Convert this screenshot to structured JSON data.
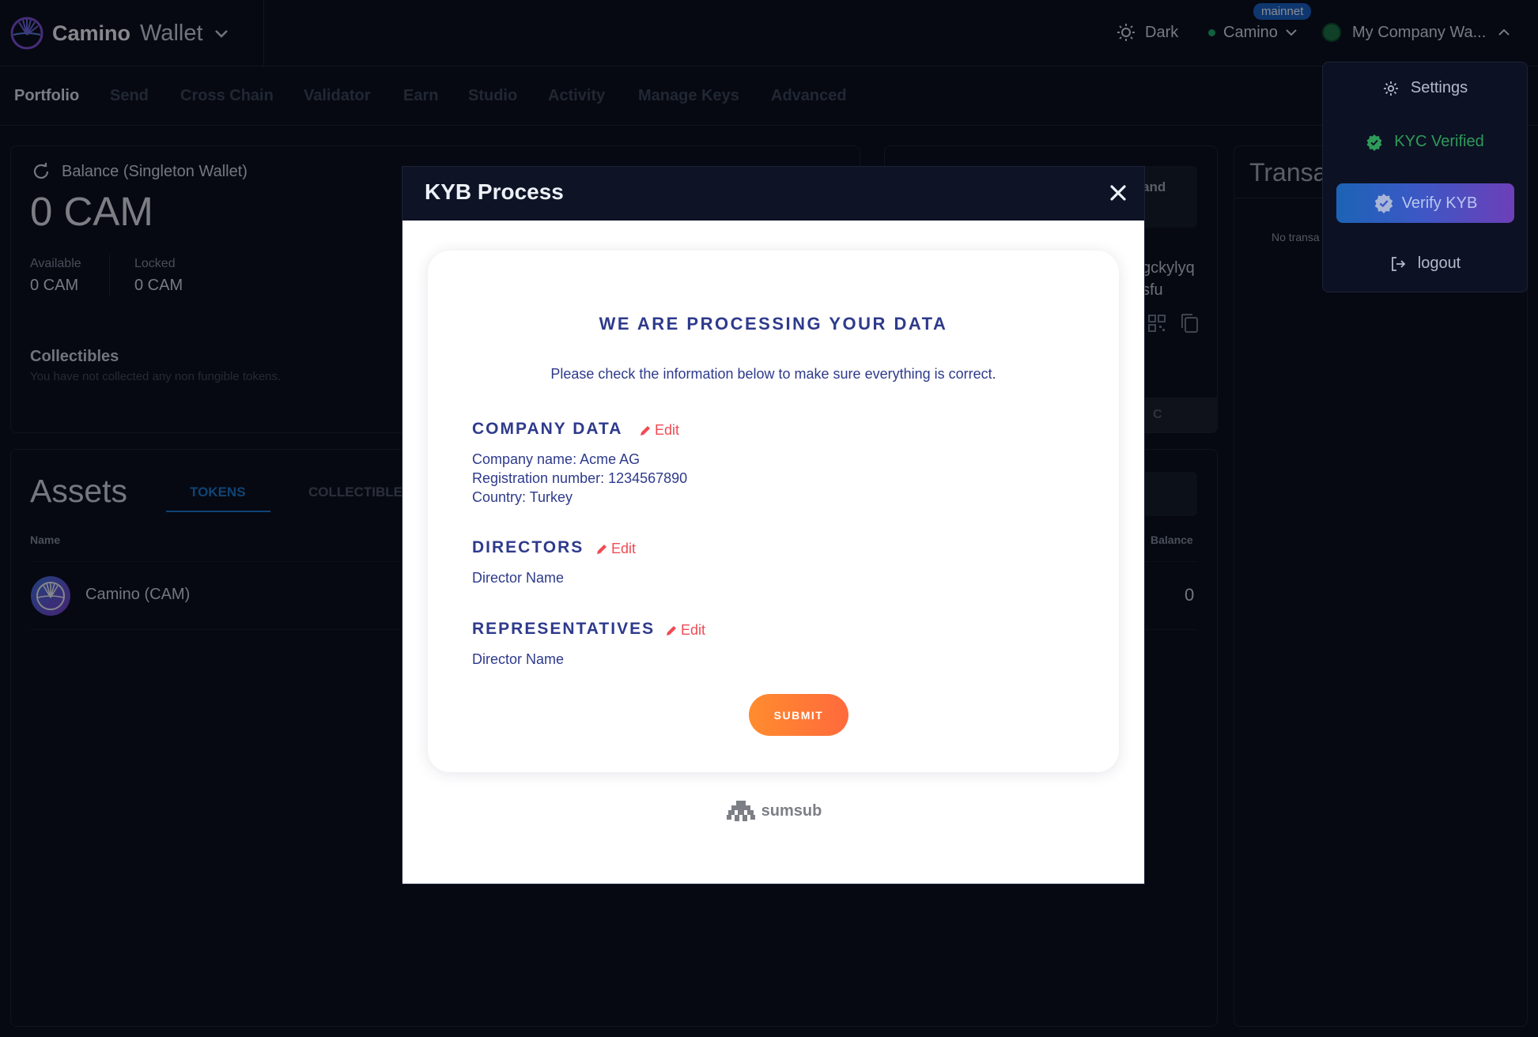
{
  "header": {
    "brand_name": "Camino",
    "brand_suffix": "Wallet",
    "theme_label": "Dark",
    "network_label": "Camino",
    "network_badge": "mainnet",
    "account_label": "My Company Wa..."
  },
  "nav": {
    "items": [
      "Portfolio",
      "Send",
      "Cross Chain",
      "Validator",
      "Earn",
      "Studio",
      "Activity",
      "Manage Keys",
      "Advanced"
    ]
  },
  "balance": {
    "title": "Balance (Singleton Wallet)",
    "value": "0 CAM",
    "available_label": "Available",
    "available_value": "0 CAM",
    "locked_label": "Locked",
    "locked_value": "0 CAM"
  },
  "collectibles": {
    "title": "Collectibles",
    "subtitle": "You have not collected any non fungible tokens."
  },
  "wallet_panel": {
    "box_text": "and",
    "address_line1": "gckylyq",
    "address_line2": "sfu",
    "bar_text": "C"
  },
  "transactions": {
    "title": "Transa",
    "empty_text": "No transa"
  },
  "assets": {
    "title": "Assets",
    "tab_tokens": "TOKENS",
    "tab_collectibles": "COLLECTIBLES",
    "col_name": "Name",
    "col_balance": "Balance",
    "rows": [
      {
        "name": "Camino (CAM)",
        "balance": "0"
      }
    ]
  },
  "menu": {
    "settings": "Settings",
    "kyc": "KYC Verified",
    "kyb": "Verify KYB",
    "logout": "logout"
  },
  "modal": {
    "title": "KYB Process",
    "heading": "WE ARE PROCESSING YOUR DATA",
    "intro": "Please check the information below to make sure everything is correct.",
    "edit_label": "Edit",
    "company_title": "COMPANY DATA",
    "company_lines": [
      "Company name: Acme AG",
      "Registration number: 1234567890",
      "Country: Turkey"
    ],
    "directors_title": "DIRECTORS",
    "directors_lines": [
      "Director Name"
    ],
    "representatives_title": "REPRESENTATIVES",
    "representatives_lines": [
      "Director Name"
    ],
    "submit_label": "SUBMIT",
    "powered_by": "sumsub"
  },
  "colors": {
    "background": "#0b1020",
    "accent_blue": "#1d74c9",
    "modal_text": "#2e3a8c",
    "edit_red": "#f04b54",
    "submit_orange": "#ff7a35",
    "kyc_green": "#2f9a5a"
  },
  "icons": {
    "logo": "camino-logo-icon",
    "theme": "sun-icon",
    "refresh": "refresh-icon",
    "settings": "gear-icon",
    "kyc": "verified-badge-icon",
    "logout": "logout-icon",
    "close": "close-icon",
    "edit": "pencil-icon"
  }
}
